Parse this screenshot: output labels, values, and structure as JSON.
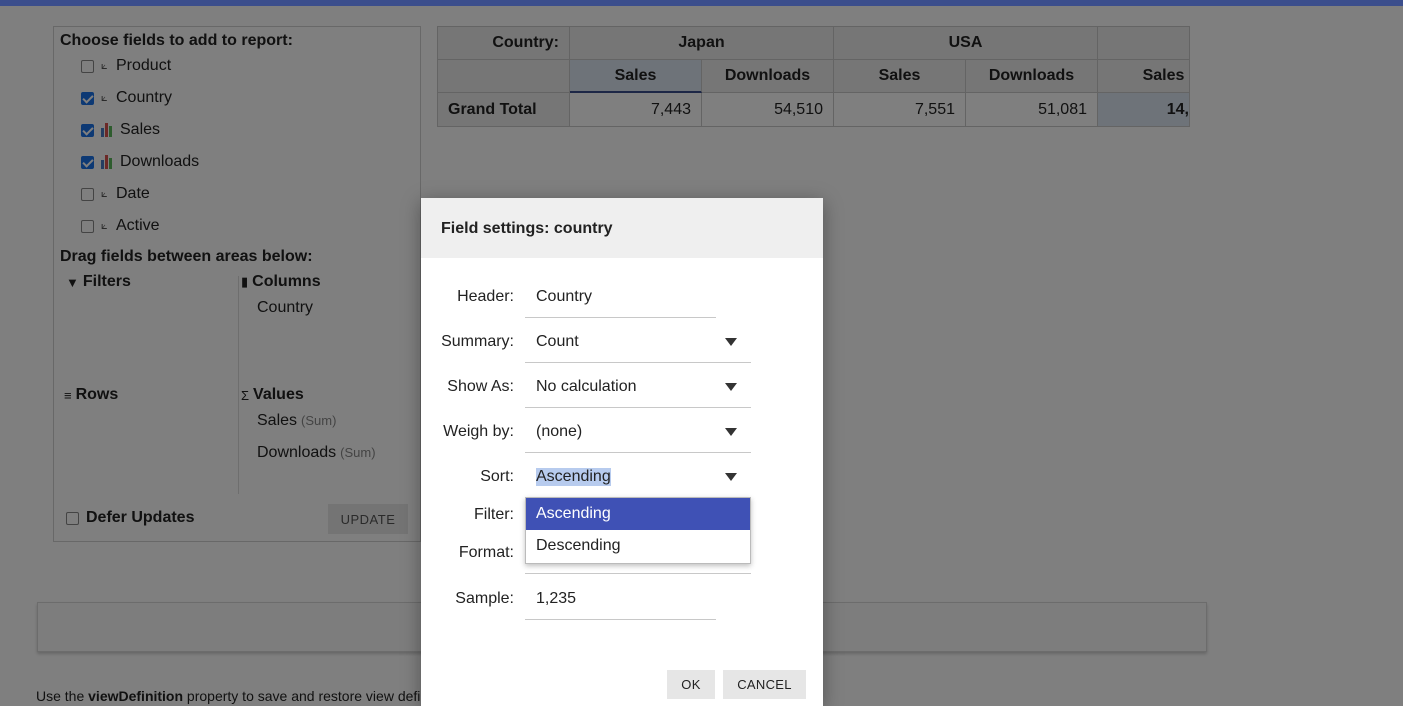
{
  "fields_panel": {
    "title": "Choose fields to add to report:",
    "fields": [
      {
        "label": "Product",
        "checked": false,
        "icon": "dimension-icon"
      },
      {
        "label": "Country",
        "checked": true,
        "icon": "dimension-icon"
      },
      {
        "label": "Sales",
        "checked": true,
        "icon": "bar-chart-icon"
      },
      {
        "label": "Downloads",
        "checked": true,
        "icon": "bar-chart-icon"
      },
      {
        "label": "Date",
        "checked": false,
        "icon": "dimension-icon"
      },
      {
        "label": "Active",
        "checked": false,
        "icon": "dimension-icon"
      }
    ],
    "drag_title": "Drag fields between areas below:",
    "areas": {
      "filters": {
        "label": "Filters",
        "items": []
      },
      "columns": {
        "label": "Columns",
        "items": [
          {
            "name": "Country"
          }
        ]
      },
      "rows": {
        "label": "Rows",
        "items": []
      },
      "values": {
        "label": "Values",
        "items": [
          {
            "name": "Sales",
            "agg": "(Sum)"
          },
          {
            "name": "Downloads",
            "agg": "(Sum)"
          }
        ]
      }
    },
    "defer_updates_label": "Defer Updates",
    "update_button": "UPDATE"
  },
  "pivot": {
    "corner_label": "Country:",
    "countries": [
      "Japan",
      "USA"
    ],
    "measures": [
      "Sales",
      "Downloads",
      "Sales",
      "Downloads",
      "Sales"
    ],
    "row_label": "Grand Total",
    "values": [
      "7,443",
      "54,510",
      "7,551",
      "51,081",
      "14,"
    ]
  },
  "footer_text": {
    "prefix": "Use the ",
    "bold": "viewDefinition",
    "suffix": " property to save and restore view defin"
  },
  "dialog": {
    "title": "Field settings: country",
    "header_label": "Header:",
    "header_value": "Country",
    "summary_label": "Summary:",
    "summary_value": "Count",
    "show_as_label": "Show As:",
    "show_as_value": "No calculation",
    "weigh_by_label": "Weigh by:",
    "weigh_by_value": "(none)",
    "sort_label": "Sort:",
    "sort_value": "Ascending",
    "filter_label": "Filter:",
    "format_label": "Format:",
    "sample_label": "Sample:",
    "sample_value": "1,235",
    "sort_options": [
      "Ascending",
      "Descending"
    ],
    "ok_button": "OK",
    "cancel_button": "CANCEL"
  },
  "colors": {
    "accent": "#3f51b5",
    "checkbox": "#1a73e8",
    "topbar": "#3b4e8c"
  }
}
